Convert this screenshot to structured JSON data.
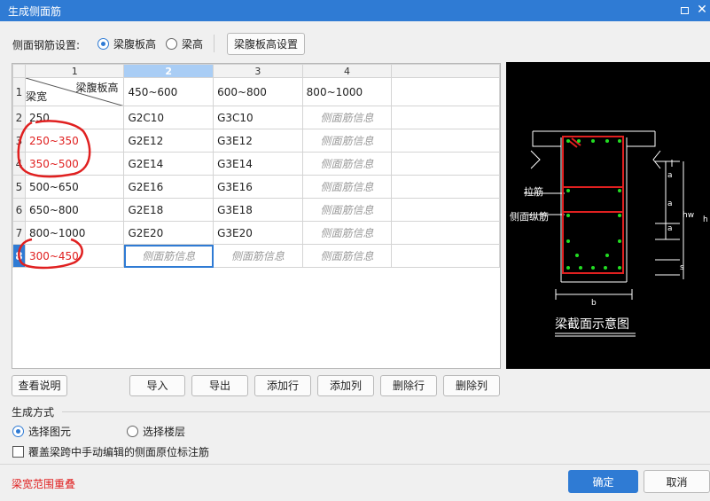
{
  "window": {
    "title": "生成侧面筋"
  },
  "settings": {
    "label": "侧面钢筋设置:",
    "options": [
      {
        "label": "梁腹板高",
        "selected": true
      },
      {
        "label": "梁高",
        "selected": false
      }
    ],
    "config_button": "梁腹板高设置"
  },
  "grid": {
    "column_numbers": [
      "1",
      "2",
      "3",
      "4"
    ],
    "row_numbers": [
      "1",
      "2",
      "3",
      "4",
      "5",
      "6",
      "7",
      "8"
    ],
    "corner": {
      "top_right": "梁腹板高",
      "bottom_left": "梁宽"
    },
    "column_headers": [
      "450~600",
      "600~800",
      "800~1000"
    ],
    "rows": [
      [
        "250",
        "G2C10",
        "G3C10",
        "侧面筋信息"
      ],
      [
        "250~350",
        "G2E12",
        "G3E12",
        "侧面筋信息"
      ],
      [
        "350~500",
        "G2E14",
        "G3E14",
        "侧面筋信息"
      ],
      [
        "500~650",
        "G2E16",
        "G3E16",
        "侧面筋信息"
      ],
      [
        "650~800",
        "G2E18",
        "G3E18",
        "侧面筋信息"
      ],
      [
        "800~1000",
        "G2E20",
        "G3E20",
        "侧面筋信息"
      ],
      [
        "300~450",
        "侧面筋信息",
        "侧面筋信息",
        "侧面筋信息"
      ]
    ]
  },
  "preview": {
    "caption": "梁截面示意图",
    "labels": {
      "tie_bar": "拉筋",
      "side_bar": "侧面纵筋",
      "a": "a",
      "hw": "hw",
      "h": "h",
      "s": "s",
      "b": "b"
    }
  },
  "actions": {
    "help": "查看说明",
    "import": "导入",
    "export": "导出",
    "add_row": "添加行",
    "add_col": "添加列",
    "del_row": "删除行",
    "del_col": "删除列"
  },
  "generate": {
    "title": "生成方式",
    "options": [
      {
        "label": "选择图元",
        "selected": true
      },
      {
        "label": "选择楼层",
        "selected": false
      }
    ],
    "checkbox_label": "覆盖梁跨中手动编辑的侧面原位标注筋",
    "checkbox_checked": false
  },
  "footer": {
    "warning": "梁宽范围重叠",
    "ok": "确定",
    "cancel": "取消"
  },
  "colors": {
    "accent": "#2f7bd4",
    "warning": "#e02020",
    "drawing_red": "#e02020",
    "drawing_green": "#22dd22"
  }
}
